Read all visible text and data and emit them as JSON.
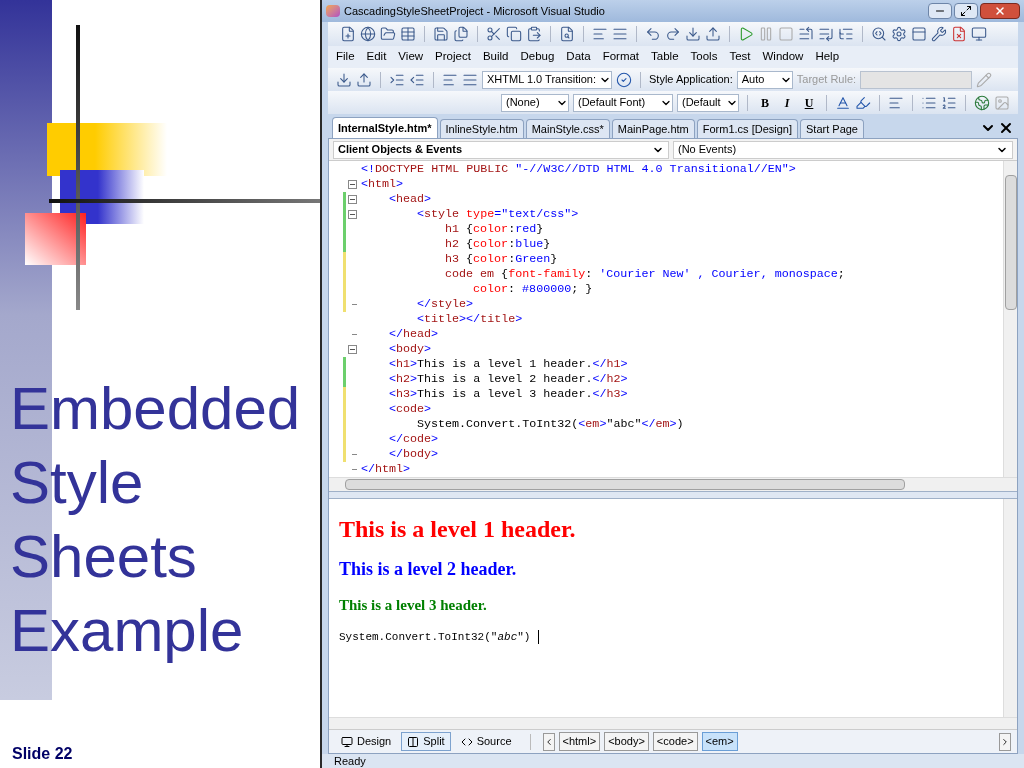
{
  "slide": {
    "title_lines": [
      "Embedded",
      "Style",
      "Sheets",
      "Example"
    ],
    "footer": "Slide 22"
  },
  "window": {
    "title": "CascadingStyleSheetProject - Microsoft Visual Studio"
  },
  "menu": [
    "File",
    "Edit",
    "View",
    "Project",
    "Build",
    "Debug",
    "Data",
    "Format",
    "Table",
    "Tools",
    "Test",
    "Window",
    "Help"
  ],
  "html_toolbar": {
    "doctype": "XHTML 1.0 Transition:",
    "style_application_label": "Style Application:",
    "style_application": "Auto",
    "target_rule_label": "Target Rule:",
    "target_rule_disabled": true
  },
  "format_toolbar": {
    "block_format": "(None)",
    "font": "(Default Font)",
    "size": "(Default",
    "buttons": [
      "B",
      "I",
      "U"
    ]
  },
  "tabs": [
    {
      "label": "InternalStyle.htm*",
      "selected": true
    },
    {
      "label": "InlineStyle.htm",
      "selected": false
    },
    {
      "label": "MainStyle.css*",
      "selected": false
    },
    {
      "label": "MainPage.htm",
      "selected": false
    },
    {
      "label": "Form1.cs [Design]",
      "selected": false
    },
    {
      "label": "Start Page",
      "selected": false
    }
  ],
  "object_dropdown": "Client Objects & Events",
  "event_dropdown": "(No Events)",
  "code_lines": [
    {
      "collapsible": false,
      "block_end": false,
      "modified": false,
      "segments": [
        {
          "kind": "delim",
          "text": "<!"
        },
        {
          "kind": "tag",
          "text": "DOCTYPE HTML PUBLIC "
        },
        {
          "kind": "value",
          "text": "\"-//W3C//DTD HTML 4.0 Transitional//EN\""
        },
        {
          "kind": "delim",
          "text": ">"
        }
      ]
    },
    {
      "collapsible": true,
      "block_end": false,
      "modified": false,
      "segments": [
        {
          "kind": "delim",
          "text": "<"
        },
        {
          "kind": "tag",
          "text": "html"
        },
        {
          "kind": "delim",
          "text": ">"
        }
      ],
      "children": [
        {
          "collapsible": true,
          "block_end": false,
          "modified": true,
          "saved": true,
          "segments": [
            {
              "kind": "delim",
              "text": "<"
            },
            {
              "kind": "tag",
              "text": "head"
            },
            {
              "kind": "delim",
              "text": ">"
            }
          ],
          "children": [
            {
              "collapsible": true,
              "block_end": false,
              "modified": true,
              "saved": true,
              "segments": [
                {
                  "kind": "delim",
                  "text": "<"
                },
                {
                  "kind": "tag",
                  "text": "style"
                },
                {
                  "kind": "attr",
                  "text": " type"
                },
                {
                  "kind": "delim",
                  "text": "="
                },
                {
                  "kind": "value",
                  "text": "\"text/css\""
                },
                {
                  "kind": "delim",
                  "text": ">"
                }
              ],
              "children": [
                {
                  "collapsible": false,
                  "block_end": false,
                  "modified": true,
                  "saved": true,
                  "segments": [
                    {
                      "kind": "tag",
                      "text": "h1 "
                    },
                    {
                      "kind": "plain",
                      "text": "{"
                    },
                    {
                      "kind": "attr",
                      "text": "color"
                    },
                    {
                      "kind": "plain",
                      "text": ":"
                    },
                    {
                      "kind": "value",
                      "text": "red"
                    },
                    {
                      "kind": "plain",
                      "text": "}"
                    }
                  ]
                },
                {
                  "collapsible": false,
                  "block_end": false,
                  "modified": true,
                  "saved": true,
                  "segments": [
                    {
                      "kind": "tag",
                      "text": "h2 "
                    },
                    {
                      "kind": "plain",
                      "text": "{"
                    },
                    {
                      "kind": "attr",
                      "text": "color"
                    },
                    {
                      "kind": "plain",
                      "text": ":"
                    },
                    {
                      "kind": "value",
                      "text": "blue"
                    },
                    {
                      "kind": "plain",
                      "text": "}"
                    }
                  ]
                },
                {
                  "collapsible": false,
                  "block_end": false,
                  "modified": true,
                  "saved": false,
                  "segments": [
                    {
                      "kind": "tag",
                      "text": "h3 "
                    },
                    {
                      "kind": "plain",
                      "text": "{"
                    },
                    {
                      "kind": "attr",
                      "text": "color"
                    },
                    {
                      "kind": "plain",
                      "text": ":"
                    },
                    {
                      "kind": "value",
                      "text": "Green"
                    },
                    {
                      "kind": "plain",
                      "text": "}"
                    }
                  ]
                },
                {
                  "collapsible": false,
                  "block_end": false,
                  "modified": true,
                  "saved": false,
                  "segments": [
                    {
                      "kind": "tag",
                      "text": "code em "
                    },
                    {
                      "kind": "plain",
                      "text": "{"
                    },
                    {
                      "kind": "attr",
                      "text": "font-family"
                    },
                    {
                      "kind": "plain",
                      "text": ": "
                    },
                    {
                      "kind": "value",
                      "text": "'Courier New' , Courier, monospace"
                    },
                    {
                      "kind": "plain",
                      "text": ";"
                    }
                  ],
                  "children": [
                    {
                      "collapsible": false,
                      "block_end": false,
                      "modified": true,
                      "saved": false,
                      "segments": [
                        {
                          "kind": "attr",
                          "text": "color"
                        },
                        {
                          "kind": "plain",
                          "text": ": "
                        },
                        {
                          "kind": "value",
                          "text": "#800000"
                        },
                        {
                          "kind": "plain",
                          "text": "; }"
                        }
                      ]
                    }
                  ]
                }
              ]
            },
            {
              "collapsible": false,
              "block_end": true,
              "modified": true,
              "saved": false,
              "segments": [
                {
                  "kind": "delim",
                  "text": "</"
                },
                {
                  "kind": "tag",
                  "text": "style"
                },
                {
                  "kind": "delim",
                  "text": ">"
                }
              ]
            },
            {
              "collapsible": false,
              "block_end": false,
              "modified": false,
              "segments": [
                {
                  "kind": "delim",
                  "text": "<"
                },
                {
                  "kind": "tag",
                  "text": "title"
                },
                {
                  "kind": "delim",
                  "text": "></"
                },
                {
                  "kind": "tag",
                  "text": "title"
                },
                {
                  "kind": "delim",
                  "text": ">"
                }
              ]
            }
          ]
        },
        {
          "collapsible": false,
          "block_end": true,
          "modified": false,
          "segments": [
            {
              "kind": "delim",
              "text": "</"
            },
            {
              "kind": "tag",
              "text": "head"
            },
            {
              "kind": "delim",
              "text": ">"
            }
          ]
        },
        {
          "collapsible": true,
          "block_end": false,
          "modified": false,
          "segments": [
            {
              "kind": "delim",
              "text": "<"
            },
            {
              "kind": "tag",
              "text": "body"
            },
            {
              "kind": "delim",
              "text": ">"
            }
          ]
        },
        {
          "collapsible": false,
          "block_end": false,
          "modified": true,
          "saved": true,
          "segments": [
            {
              "kind": "delim",
              "text": "<"
            },
            {
              "kind": "tag",
              "text": "h1"
            },
            {
              "kind": "delim",
              "text": ">"
            },
            {
              "kind": "plain",
              "text": "This is a level 1 header."
            },
            {
              "kind": "delim",
              "text": "</"
            },
            {
              "kind": "tag",
              "text": "h1"
            },
            {
              "kind": "delim",
              "text": ">"
            }
          ]
        },
        {
          "collapsible": false,
          "block_end": false,
          "modified": true,
          "saved": true,
          "segments": [
            {
              "kind": "delim",
              "text": "<"
            },
            {
              "kind": "tag",
              "text": "h2"
            },
            {
              "kind": "delim",
              "text": ">"
            },
            {
              "kind": "plain",
              "text": "This is a level 2 header."
            },
            {
              "kind": "delim",
              "text": "</"
            },
            {
              "kind": "tag",
              "text": "h2"
            },
            {
              "kind": "delim",
              "text": ">"
            }
          ]
        },
        {
          "collapsible": false,
          "block_end": false,
          "modified": true,
          "saved": false,
          "segments": [
            {
              "kind": "delim",
              "text": "<"
            },
            {
              "kind": "tag",
              "text": "h3"
            },
            {
              "kind": "delim",
              "text": ">"
            },
            {
              "kind": "plain",
              "text": "This is a level 3 header."
            },
            {
              "kind": "delim",
              "text": "</"
            },
            {
              "kind": "tag",
              "text": "h3"
            },
            {
              "kind": "delim",
              "text": ">"
            }
          ]
        },
        {
          "collapsible": false,
          "block_end": false,
          "modified": true,
          "saved": false,
          "segments": [
            {
              "kind": "delim",
              "text": "<"
            },
            {
              "kind": "tag",
              "text": "code"
            },
            {
              "kind": "delim",
              "text": ">"
            }
          ],
          "children": [
            {
              "collapsible": false,
              "block_end": false,
              "modified": true,
              "saved": false,
              "segments": [
                {
                  "kind": "plain",
                  "text": "System.Convert.ToInt32("
                },
                {
                  "kind": "delim",
                  "text": "<"
                },
                {
                  "kind": "tag",
                  "text": "em"
                },
                {
                  "kind": "delim",
                  "text": ">"
                },
                {
                  "kind": "plain",
                  "text": "\"abc\""
                },
                {
                  "kind": "delim",
                  "text": "</"
                },
                {
                  "kind": "tag",
                  "text": "em"
                },
                {
                  "kind": "delim",
                  "text": ">"
                },
                {
                  "kind": "plain",
                  "text": ")"
                }
              ]
            }
          ]
        },
        {
          "collapsible": false,
          "block_end": false,
          "modified": true,
          "saved": false,
          "segments": [
            {
              "kind": "delim",
              "text": "</"
            },
            {
              "kind": "tag",
              "text": "code"
            },
            {
              "kind": "delim",
              "text": ">"
            }
          ]
        },
        {
          "collapsible": false,
          "block_end": true,
          "modified": true,
          "saved": false,
          "segments": [
            {
              "kind": "delim",
              "text": "</"
            },
            {
              "kind": "tag",
              "text": "body"
            },
            {
              "kind": "delim",
              "text": ">"
            }
          ]
        }
      ]
    },
    {
      "collapsible": false,
      "block_end": true,
      "modified": false,
      "segments": [
        {
          "kind": "delim",
          "text": "</"
        },
        {
          "kind": "tag",
          "text": "html"
        },
        {
          "kind": "delim",
          "text": ">"
        }
      ]
    }
  ],
  "preview": {
    "h1": "This is a level 1 header.",
    "h2": "This is a level 2 header.",
    "h3": "This is a level 3 header.",
    "code": "System.Convert.ToInt32(\"*abc*\")"
  },
  "view_tabs": [
    {
      "label": "Design",
      "selected": false
    },
    {
      "label": "Split",
      "selected": true
    },
    {
      "label": "Source",
      "selected": false
    }
  ],
  "breadcrumbs": [
    {
      "label": "<html>",
      "selected": false
    },
    {
      "label": "<body>",
      "selected": false
    },
    {
      "label": "<code>",
      "selected": false
    },
    {
      "label": "<em>",
      "selected": true
    }
  ],
  "status_bar": "Ready"
}
